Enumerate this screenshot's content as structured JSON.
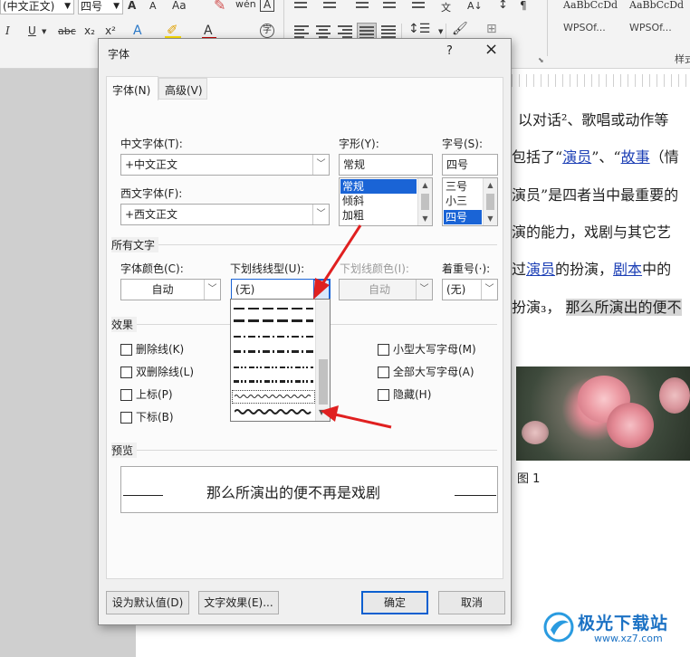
{
  "ribbon": {
    "font_name": "(中文正文)",
    "font_size": "四号",
    "font_grow": "A",
    "font_shrink": "A",
    "change_case": "Aa",
    "char_border": "A",
    "italic": "I",
    "underline": "U",
    "strikethrough": "abc",
    "subscript": "x₂",
    "superscript": "x²",
    "font_color": "A",
    "enclose_char": "字",
    "styles": [
      "AaBbCcDd",
      "AaBbCcDd"
    ],
    "style_names": [
      "WPSOf...",
      "WPSOf..."
    ],
    "style_group_label": "样式"
  },
  "document": {
    "line1": "以对话²、歌唱或动作等",
    "line2_parts": [
      "包括了“",
      "演员",
      "”、“",
      "故事",
      "（情"
    ],
    "line3": "演员”是四者当中最重要的",
    "line4": "演的能力，戏剧与其它艺",
    "line5_parts": [
      "过",
      "演员",
      "的扮演，",
      "剧本",
      "中的"
    ],
    "line6_parts": [
      "扮演₃，",
      "那么所演出的便不"
    ],
    "figure_caption": "图 1",
    "watermark_text": "极光下载站",
    "watermark_url": "www.xz7.com"
  },
  "dialog": {
    "title": "字体",
    "help": "?",
    "close": "×",
    "tabs": [
      "字体(N)",
      "高级(V)"
    ],
    "chinese_font_label": "中文字体(T):",
    "chinese_font_value": "+中文正文",
    "western_font_label": "西文字体(F):",
    "western_font_value": "+西文正文",
    "style_label": "字形(Y):",
    "style_value": "常规",
    "style_options": [
      "常规",
      "倾斜",
      "加粗"
    ],
    "size_label": "字号(S):",
    "size_value": "四号",
    "size_options": [
      "三号",
      "小三",
      "四号"
    ],
    "all_text_group": "所有文字",
    "font_color_label": "字体颜色(C):",
    "font_color_value": "自动",
    "underline_type_label": "下划线线型(U):",
    "underline_type_value": "(无)",
    "underline_color_label": "下划线颜色(I):",
    "underline_color_value": "自动",
    "emphasis_label": "着重号(·):",
    "emphasis_value": "(无)",
    "effects_group": "效果",
    "effects": [
      "删除线(K)",
      "双删除线(L)",
      "上标(P)",
      "下标(B)"
    ],
    "effects_right": [
      "小型大写字母(M)",
      "全部大写字母(A)",
      "隐藏(H)"
    ],
    "preview_group": "预览",
    "preview_text": "那么所演出的便不再是戏剧",
    "set_default_button": "设为默认值(D)",
    "text_effect_button": "文字效果(E)...",
    "ok_button": "确定",
    "cancel_button": "取消"
  },
  "colors": {
    "selection": "#1a64d6",
    "arrow": "#e02020",
    "link": "#1c3fb5",
    "font_color_bar": "#c00000"
  }
}
